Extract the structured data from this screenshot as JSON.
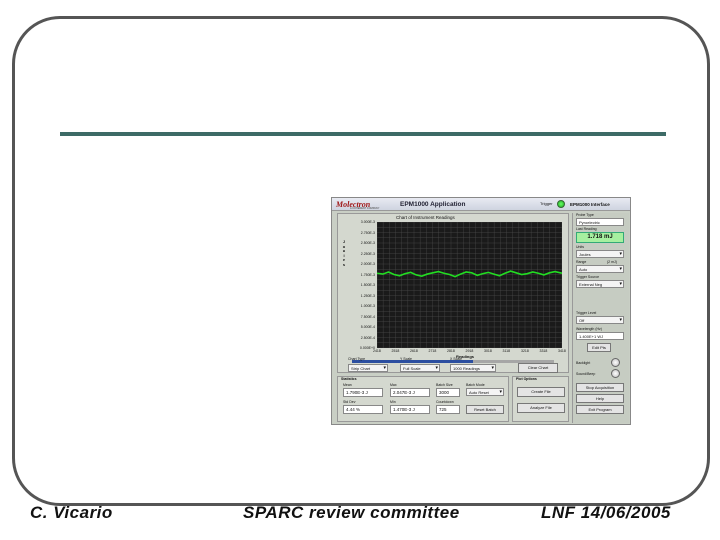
{
  "footer": {
    "author": "C. Vicario",
    "event": "SPARC review committee",
    "venue_date": "LNF 14/06/2005"
  },
  "app": {
    "logo": "Molectron",
    "logo_subtitle": "A COHERENT COMPANY",
    "title": "EPM1000 Application",
    "trigger_label": "Trigger",
    "interface_title": "EPM1000 Interface",
    "chart_title": "Chart of Instrument Readings",
    "y_axis_label": "Joules",
    "x_axis_label": "Readings",
    "controls": {
      "chart_type_label": "Chart Type",
      "chart_type_value": "Strip Chart",
      "scale_label": "Y Scale",
      "scale_value": "Full Scale",
      "xscale_label": "X Scale",
      "xscale_value": "1000 Readings",
      "clear_chart": "Clear Chart"
    },
    "statistics": {
      "section_label": "Statistics",
      "mean_label": "Mean",
      "mean_value": "1.790E-3 J",
      "max_label": "Max",
      "max_value": "2.047E-3 J",
      "batch_size_label": "Batch Size",
      "batch_size_value": "3000",
      "batch_mode_label": "Batch Mode",
      "batch_mode_value": "Auto Reset",
      "stddev_label": "Std Dev",
      "stddev_value": "4.44 %",
      "min_label": "Min",
      "min_value": "1.470E-3 J",
      "countdown_label": "Countdown",
      "countdown_value": "725",
      "reset_batch": "Reset Batch"
    },
    "plot_options": {
      "section_label": "Plot Options",
      "create_file": "Create File",
      "analyze_file": "Analyze File"
    },
    "side": {
      "probe_type_label": "Probe Type",
      "probe_type_value": "Pyroelectric",
      "last_reading_label": "Last Reading",
      "last_reading_value": "1.718 mJ",
      "units_label": "Units",
      "units_value": "Joules",
      "range_label": "Range",
      "range_value": "Auto",
      "range_max": "(2 mJ)",
      "trigger_source_label": "Trigger Source",
      "trigger_source_value": "External Neg",
      "trigger_level_label": "Trigger Level",
      "trigger_level_value": "Off",
      "wavelength_label": "Wavelength (Hz)",
      "wavelength_value": "1.400E+1 WJ",
      "edit_btn": "Edit Pts",
      "backlight_label": "Backlight",
      "sound_label": "Sound/Beep",
      "stop_acq": "Stop Acquisition",
      "help": "Help",
      "exit": "Exit Program"
    }
  },
  "chart_data": {
    "type": "line",
    "title": "Chart of Instrument Readings",
    "xlabel": "Readings",
    "ylabel": "Joules",
    "y_ticks": [
      "3.000E-3",
      "2.750E-3",
      "2.500E-3",
      "2.250E-3",
      "2.000E-3",
      "1.750E-3",
      "1.500E-3",
      "1.250E-3",
      "1.000E-3",
      "7.500E-4",
      "5.000E-4",
      "2.500E-4",
      "0.000E+0"
    ],
    "x_ticks": [
      "2418",
      "2518",
      "2618",
      "2718",
      "2818",
      "2918",
      "3018",
      "3118",
      "3218",
      "3318",
      "3418"
    ],
    "xlim": [
      2418,
      3418
    ],
    "ylim": [
      0,
      0.003
    ],
    "grid": true,
    "series": [
      {
        "color": "#22dd22",
        "x": [
          2418,
          2450,
          2480,
          2510,
          2540,
          2570,
          2600,
          2630,
          2660,
          2690,
          2720,
          2750,
          2780,
          2810,
          2840,
          2870,
          2900,
          2930,
          2960,
          2990,
          3020,
          3050,
          3080,
          3110,
          3140,
          3170,
          3200,
          3230,
          3260,
          3290,
          3320,
          3350,
          3380,
          3418
        ],
        "y": [
          0.00178,
          0.00176,
          0.00181,
          0.00175,
          0.00172,
          0.00177,
          0.0018,
          0.00174,
          0.00171,
          0.00176,
          0.00179,
          0.00182,
          0.00178,
          0.00175,
          0.0017,
          0.00176,
          0.00181,
          0.00179,
          0.00173,
          0.00177,
          0.0018,
          0.00176,
          0.00172,
          0.00178,
          0.00183,
          0.00179,
          0.00175,
          0.00177,
          0.00181,
          0.00178,
          0.00174,
          0.00179,
          0.00182,
          0.00178
        ]
      }
    ]
  }
}
